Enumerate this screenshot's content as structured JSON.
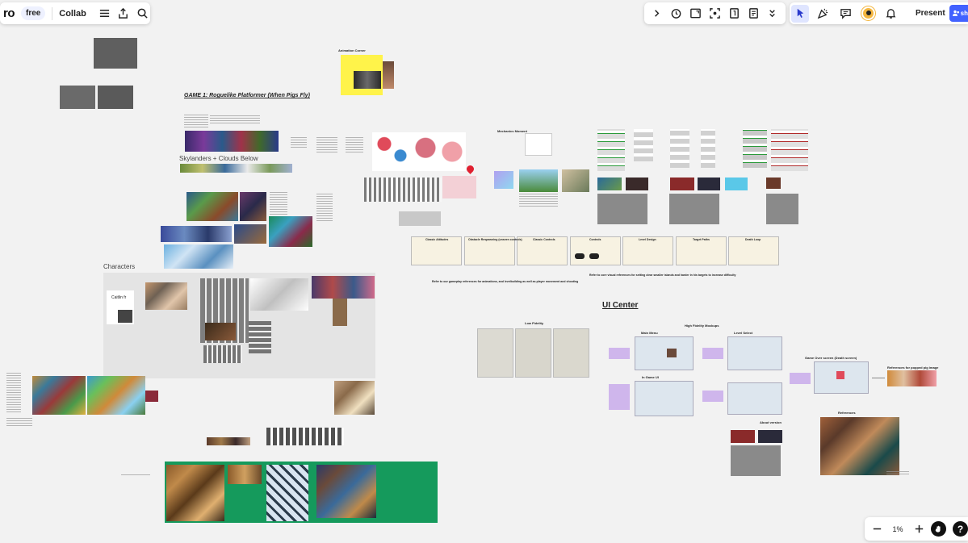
{
  "app": {
    "logo_text": "ro",
    "plan_badge": "free",
    "board_name": "Collab"
  },
  "toolbar_left": {
    "icons": [
      "menu-icon",
      "share-upload-icon",
      "search-icon"
    ]
  },
  "toolbar_mid": {
    "icons": [
      "chevron-right-icon",
      "timer-icon",
      "frame-icon",
      "focus-icon",
      "number-icon",
      "notes-icon",
      "chevron-double-down-icon"
    ]
  },
  "toolbar_right": {
    "present_label": "Present",
    "icons": [
      "cursor-icon",
      "celebrate-icon",
      "comment-icon",
      "avatar-icon",
      "bell-icon",
      "chevron-down-icon",
      "share-users-icon"
    ],
    "share_label": "sh"
  },
  "zoom": {
    "value": "1%"
  },
  "board": {
    "title_game1": "GAME 1: Roguelike Platformer (When Pigs Fly)",
    "skylanders": "Skylanders + Clouds Below",
    "characters": "Characters",
    "caitlin": "Caitlin fr",
    "ui_center": "UI Center",
    "low_fidelity": "Low Fidelity",
    "high_fidelity": "High Fidelity Mockups",
    "main_menu": "Main Menu",
    "level_select": "Level Select",
    "in_game_ui": "In Game UI",
    "game_over": "Game Over screen (Death screen)",
    "refs_popped": "References for popped pig image",
    "references": "References",
    "about_version": "About version",
    "animation_corner": "Animation Corner",
    "mechanics_moment": "Mechanics Moment",
    "refer_text_1": "Refer to our gameplay references for animations, and levelbuilding as well as player movement and shooting",
    "refer_text_2": "Refer to core visual references for setting clear smaller islands and harder in his targets to increase difficulty",
    "strips": [
      "Classic Attitudes",
      "Obstacle Respawning (unseen controls)",
      "Classic Controls",
      "Controls",
      "Level Design",
      "Target Paths",
      "Death Loop"
    ]
  },
  "colors": {
    "accent": "#4262ff",
    "sticky_yellow": "#fff34a",
    "green_board": "#159a5c",
    "gray_frame": "#e4e4e4"
  }
}
